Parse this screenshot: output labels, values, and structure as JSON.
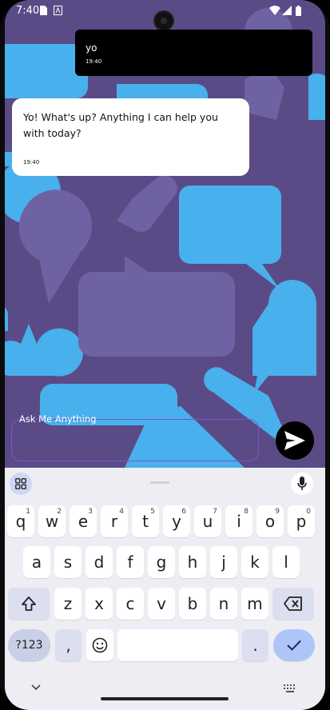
{
  "status": {
    "time": "7:40",
    "icons": [
      "sim-card-icon",
      "notification-icon",
      "wifi-icon",
      "battery-icon"
    ]
  },
  "chat": {
    "messages": [
      {
        "role": "user",
        "text": "yo",
        "time": "19:40"
      },
      {
        "role": "assistant",
        "text": "Yo! What's up? Anything I can help you with today?",
        "time": "19:40"
      }
    ]
  },
  "composer": {
    "label": "Ask Me Anything",
    "value": "",
    "send_icon": "send-icon"
  },
  "keyboard": {
    "rows": [
      {
        "keys": [
          "q",
          "w",
          "e",
          "r",
          "t",
          "y",
          "u",
          "i",
          "o",
          "p"
        ],
        "hints": [
          "1",
          "2",
          "3",
          "4",
          "5",
          "6",
          "7",
          "8",
          "9",
          "0"
        ]
      },
      {
        "keys": [
          "a",
          "s",
          "d",
          "f",
          "g",
          "h",
          "j",
          "k",
          "l"
        ]
      },
      {
        "keys": [
          "z",
          "x",
          "c",
          "v",
          "b",
          "n",
          "m"
        ]
      }
    ],
    "symbols_label": "?123",
    "comma": ",",
    "period": ".",
    "emoji_icon": "emoji-icon",
    "shift_icon": "shift-icon",
    "backspace_icon": "backspace-icon",
    "enter_icon": "check-icon",
    "mic_icon": "mic-icon",
    "apps_icon": "apps-grid-icon"
  },
  "colors": {
    "wallpaper": "#5a4b87",
    "bubble_light": "#48b0ec",
    "bubble_dark": "#6f62a3",
    "accent": "#7b55c7",
    "enter": "#aec6f7"
  }
}
